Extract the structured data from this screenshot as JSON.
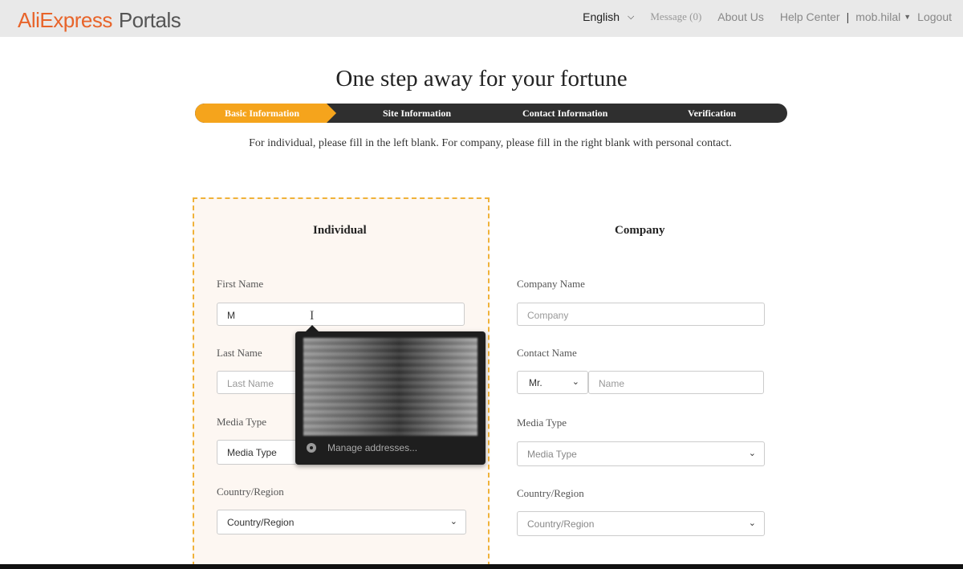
{
  "header": {
    "brand": "AliExpress",
    "product": "Portals",
    "language": "English",
    "message": "Message (0)",
    "about": "About Us",
    "help": "Help Center",
    "separator": "|",
    "user": "mob.hilal",
    "logout": "Logout"
  },
  "page": {
    "headline": "One step away for your fortune",
    "instruction": "For individual, please fill in the left blank. For company, please fill in the right blank with personal contact."
  },
  "steps": [
    {
      "label": "Basic Information",
      "active": true
    },
    {
      "label": "Site Information",
      "active": false
    },
    {
      "label": "Contact Information",
      "active": false
    },
    {
      "label": "Verification",
      "active": false
    }
  ],
  "individual": {
    "title": "Individual",
    "first_name_label": "First Name",
    "first_name_value": "M",
    "last_name_label": "Last Name",
    "last_name_placeholder": "Last Name",
    "media_type_label": "Media Type",
    "media_type_value": "Media Type",
    "country_label": "Country/Region",
    "country_value": "Country/Region"
  },
  "company": {
    "title": "Company",
    "company_name_label": "Company Name",
    "company_name_placeholder": "Company",
    "contact_name_label": "Contact Name",
    "salutation_value": "Mr.",
    "contact_name_placeholder": "Name",
    "media_type_label": "Media Type",
    "media_type_value": "Media Type",
    "country_label": "Country/Region",
    "country_value": "Country/Region"
  },
  "autofill": {
    "manage_label": "Manage addresses..."
  },
  "colors": {
    "brand_orange": "#e8642a",
    "step_active": "#f5a41c",
    "step_bar": "#2f2f2f",
    "panel_border": "#f0b23a",
    "panel_bg": "#fdf7f2"
  }
}
